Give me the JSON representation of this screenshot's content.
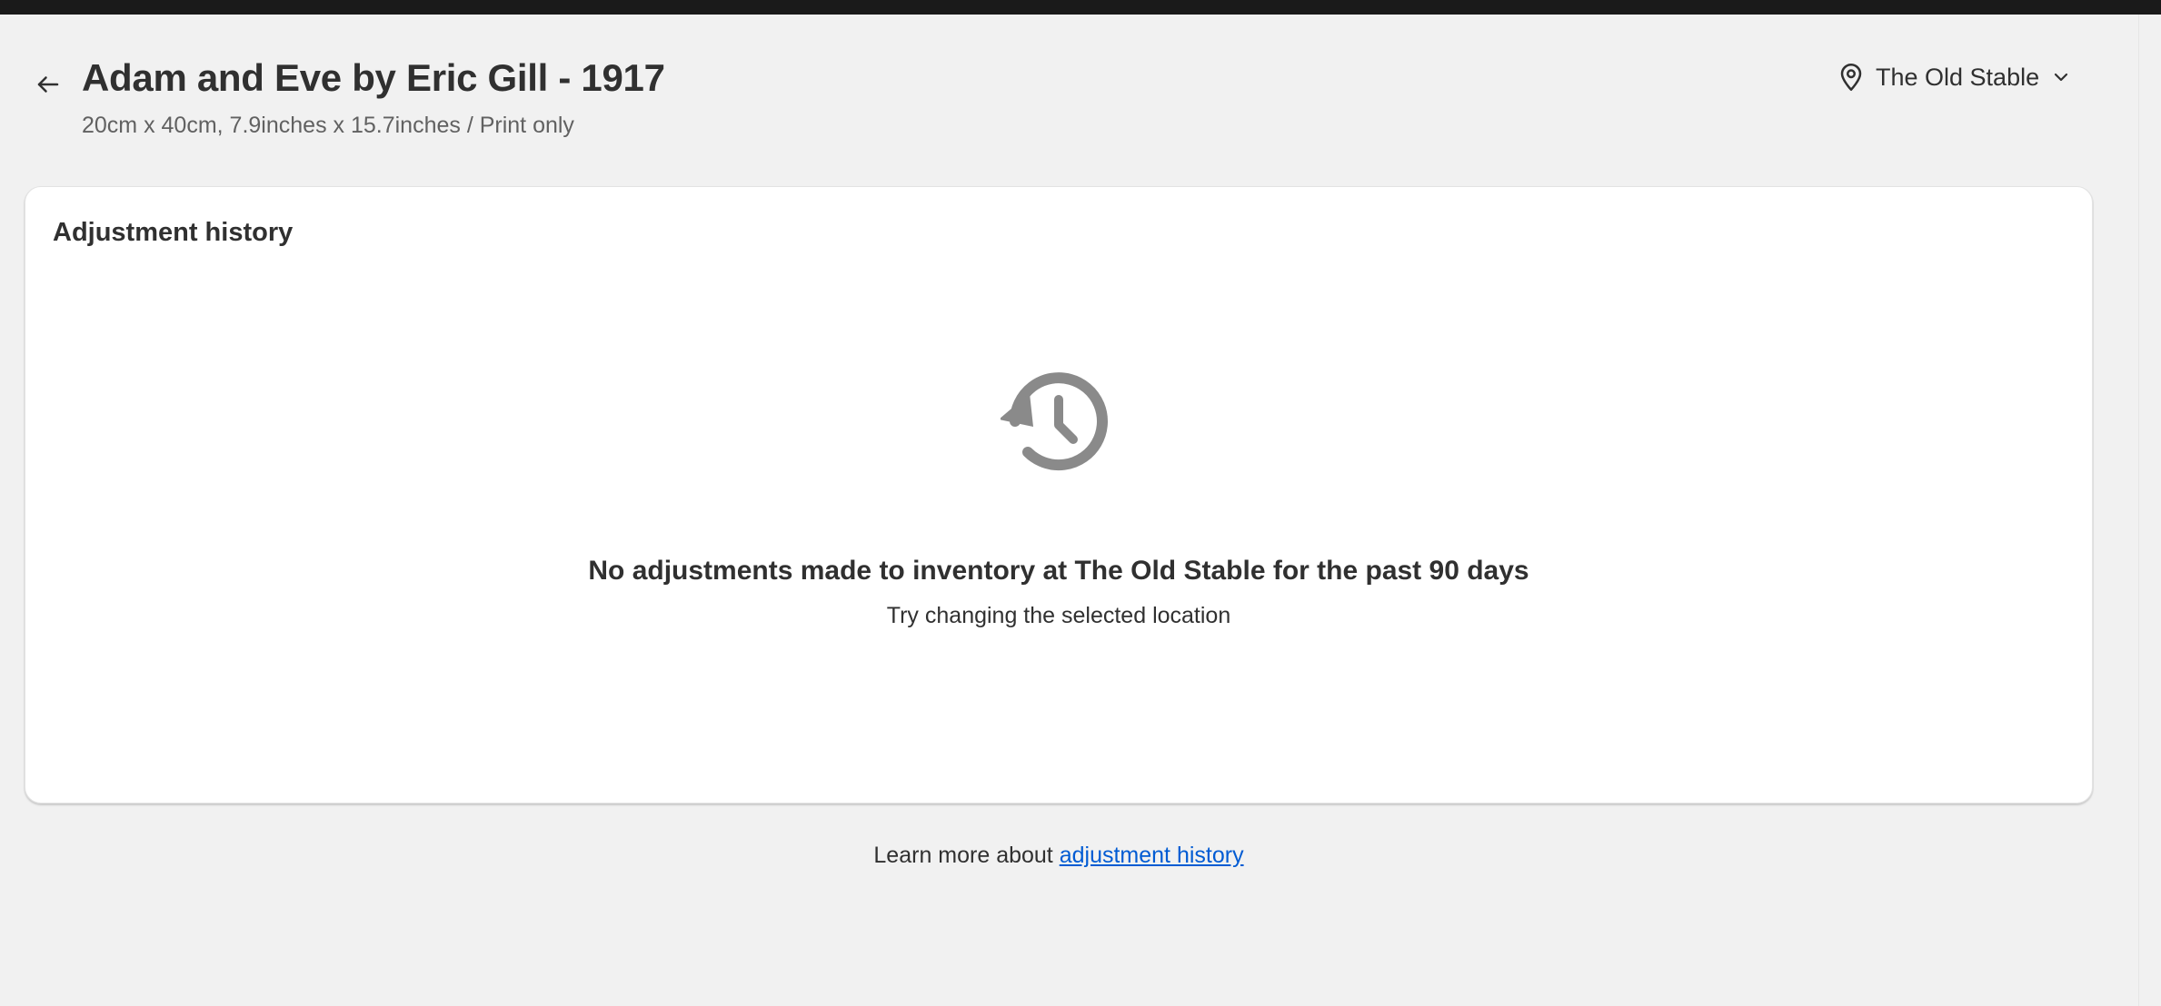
{
  "header": {
    "title": "Adam and Eve by Eric Gill - 1917",
    "subtitle": "20cm x 40cm, 7.9inches x 15.7inches / Print only",
    "location": "The Old Stable"
  },
  "card": {
    "title": "Adjustment history",
    "empty_heading": "No adjustments made to inventory at The Old Stable for the past 90 days",
    "empty_subtext": "Try changing the selected location"
  },
  "footer": {
    "prefix": "Learn more about ",
    "link_text": "adjustment history"
  },
  "icons": {
    "back": "arrow-left-icon",
    "location": "location-pin-icon",
    "dropdown": "chevron-down-icon",
    "empty_state": "history-clock-icon"
  },
  "colors": {
    "background": "#f1f1f1",
    "topbar": "#1a1a1a",
    "card": "#ffffff",
    "text": "#303030",
    "subdued_text": "#616161",
    "icon_gray": "#8a8a8a",
    "link": "#005bd3"
  }
}
